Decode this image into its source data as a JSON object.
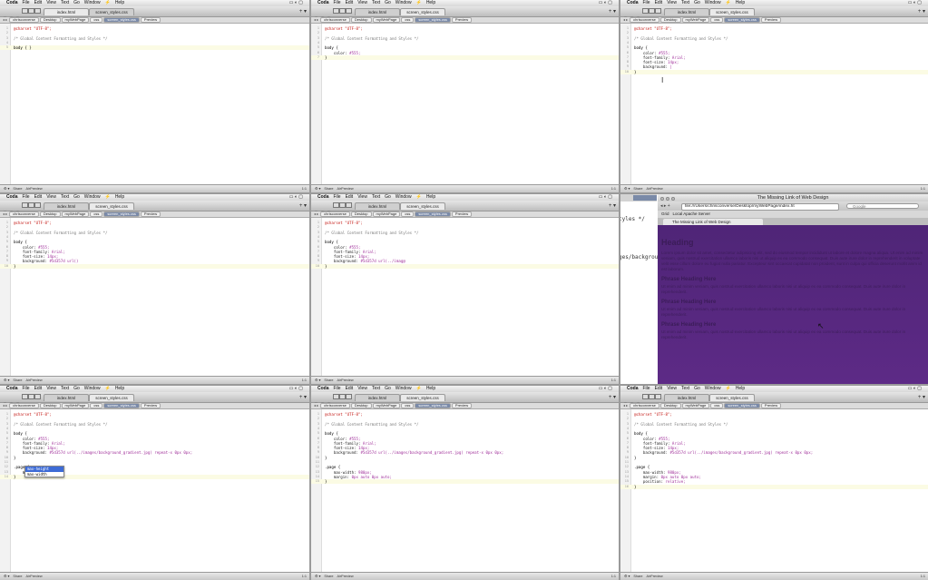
{
  "menubar": {
    "apple": "",
    "app_name": "Coda",
    "items": [
      "File",
      "Edit",
      "View",
      "Text",
      "Go",
      "Window",
      "⚡",
      "Help"
    ]
  },
  "tabs": {
    "index": "index.html",
    "style": "screen_styles.css"
  },
  "breadcrumbs": [
    "chrisconverse",
    "Desktop",
    "myWebPage",
    "css",
    "screen_styles.css"
  ],
  "preview_label": "Preview",
  "status": {
    "left": "Share",
    "preview": "AirPreview",
    "right": "1:1"
  },
  "panels": [
    {
      "lines": [
        "@charset \"UTF-8\";",
        "",
        "/* Global Content Formatting and Styles */",
        "",
        "body { }"
      ]
    },
    {
      "lines": [
        "@charset \"UTF-8\";",
        "",
        "/* Global Content Formatting and Styles */",
        "",
        "body {",
        "    color: #555;",
        "}"
      ]
    },
    {
      "lines": [
        "@charset \"UTF-8\";",
        "",
        "/* Global Content Formatting and Styles */",
        "",
        "body {",
        "    color: #555;",
        "    font-family: Arial;",
        "    font-size: 14px;",
        "    background: |",
        "}"
      ]
    },
    {
      "lines": [
        "@charset \"UTF-8\";",
        "",
        "/* Global Content Formatting and Styles */",
        "",
        "body {",
        "    color: #555;",
        "    font-family: Arial;",
        "    font-size: 14px;",
        "    background: #5d357d url()",
        "}"
      ]
    },
    {
      "lines": [
        "@charset \"UTF-8\";",
        "",
        "/* Global Content Formatting and Styles */",
        "",
        "body {",
        "    color: #555;",
        "    font-family: Arial;",
        "    font-size: 14px;",
        "    background: #5d357d url(../imag@",
        "}"
      ]
    },
    {
      "lines": []
    },
    {
      "lines": [
        "@charset \"UTF-8\";",
        "",
        "/* Global Content Formatting and Styles */",
        "",
        "body {",
        "    color: #555;",
        "    font-family: Arial;",
        "    font-size: 14px;",
        "    background: #5d357d url(../images/background_gradient.jpg) repeat-x 0px 0px;",
        "}",
        "",
        ".page {",
        "    max",
        "}"
      ]
    },
    {
      "lines": [
        "@charset \"UTF-8\";",
        "",
        "/* Global Content Formatting and Styles */",
        "",
        "body {",
        "    color: #555;",
        "    font-family: Arial;",
        "    font-size: 14px;",
        "    background: #5d357d url(../images/background_gradient.jpg) repeat-x 0px 0px;",
        "}",
        "",
        ".page {",
        "    max-width: 980px;",
        "    margin: 0px auto 0px auto;",
        "}"
      ]
    },
    {
      "lines": [
        "@charset \"UTF-8\";",
        "",
        "/* Global Content Formatting and Styles */",
        "",
        "body {",
        "    color: #555;",
        "    font-family: Arial;",
        "    font-size: 14px;",
        "    background: #5d357d url(../images/background_gradient.jpg) repeat-x 0px 0px;",
        "}",
        "",
        ".page {",
        "    max-width: 980px;",
        "    margin: 0px auto 0px auto;",
        "    position: relative;",
        "}"
      ]
    }
  ],
  "autocomplete": [
    "max-height",
    "max-width"
  ],
  "browser": {
    "title": "The Missing Link of Web Design",
    "url": "file:///Users/chrisconverse/Desktop/myWebPage/index.ht",
    "search_placeholder": "Google",
    "bookmarks": [
      "Grid",
      "Local Apache Server"
    ],
    "tab_label": "The Missing Link of Web Design",
    "behind_editor_fragment_1": "tyles */",
    "behind_editor_fragment_2": "ges/backgrou",
    "heading": "Heading",
    "paragraph": "Lorem ipsum dolor sit amet, consectetur adipisicing elit, sed do eiusmod tempor incididunt ut labore et dolore magna aliqua. Ut enim ad minim veniam, quis nostrud exercitation ullamco laboris nisi ut aliquip ex ea commodo consequat. Duis aute irure dolor in reprehenderit in voluptate velit esse cillum dolore eu fugiat nulla pariatur. Excepteur sint occaecat cupidatat non proident, sunt in culpa qui officia deserunt mollit anim id est laborum.",
    "subheadings": [
      "Phrase Heading Here",
      "Phrase Heading Here",
      "Phrase Heading Here"
    ],
    "short_para": "Ut enim ad minim veniam, quis nostrud exercitation ullamco laboris nisi ut aliquip ex ea commodo consequat. Duis aute irure dolor in reprehenderit."
  }
}
